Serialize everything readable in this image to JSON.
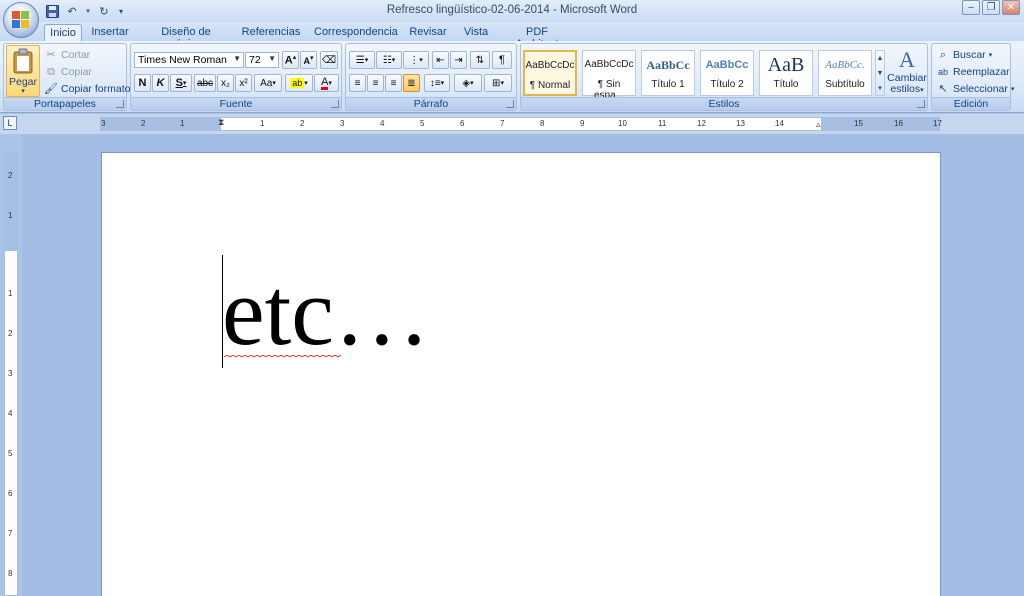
{
  "window": {
    "title": "Refresco lingüístico-02-06-2014 - Microsoft Word",
    "controls": {
      "minimize": "–",
      "restore": "❐",
      "close": "✕"
    }
  },
  "tabs": [
    {
      "label": "Inicio",
      "active": true
    },
    {
      "label": "Insertar"
    },
    {
      "label": "Diseño de página"
    },
    {
      "label": "Referencias"
    },
    {
      "label": "Correspondencia"
    },
    {
      "label": "Revisar"
    },
    {
      "label": "Vista"
    },
    {
      "label": "PDF Architect"
    }
  ],
  "ribbon": {
    "clipboard": {
      "label": "Portapapeles",
      "paste": "Pegar",
      "cut": "Cortar",
      "copy": "Copiar",
      "format_painter": "Copiar formato"
    },
    "font": {
      "label": "Fuente",
      "font_name": "Times New Roman",
      "font_size": "72",
      "bold": "N",
      "italic": "K",
      "underline": "S",
      "strike": "abc",
      "subscript": "x₂",
      "superscript": "x²",
      "change_case": "Aa"
    },
    "paragraph": {
      "label": "Párrafo",
      "pilcrow": "¶"
    },
    "styles": {
      "label": "Estilos",
      "items": [
        {
          "preview": "AaBbCcDc",
          "name": "¶ Normal"
        },
        {
          "preview": "AaBbCcDc",
          "name": "¶ Sin espa..."
        },
        {
          "preview": "AaBbCc",
          "name": "Título 1"
        },
        {
          "preview": "AaBbCc",
          "name": "Título 2"
        },
        {
          "preview": "AaB",
          "name": "Título"
        },
        {
          "preview": "AaBbCc.",
          "name": "Subtítulo"
        }
      ],
      "change_styles_line1": "Cambiar",
      "change_styles_line2": "estilos"
    },
    "editing": {
      "label": "Edición",
      "find": "Buscar",
      "replace": "Reemplazar",
      "select": "Seleccionar"
    }
  },
  "ruler": {
    "corner": "L",
    "h_labels": [
      "3",
      "2",
      "1",
      "1",
      "2",
      "3",
      "4",
      "5",
      "6",
      "7",
      "8",
      "9",
      "10",
      "11",
      "12",
      "13",
      "14",
      "15",
      "16",
      "17"
    ],
    "v_labels": [
      "2",
      "1",
      "1",
      "2",
      "3",
      "4",
      "5",
      "6",
      "7",
      "8"
    ]
  },
  "document": {
    "text": "etc…",
    "font_size": "72"
  }
}
